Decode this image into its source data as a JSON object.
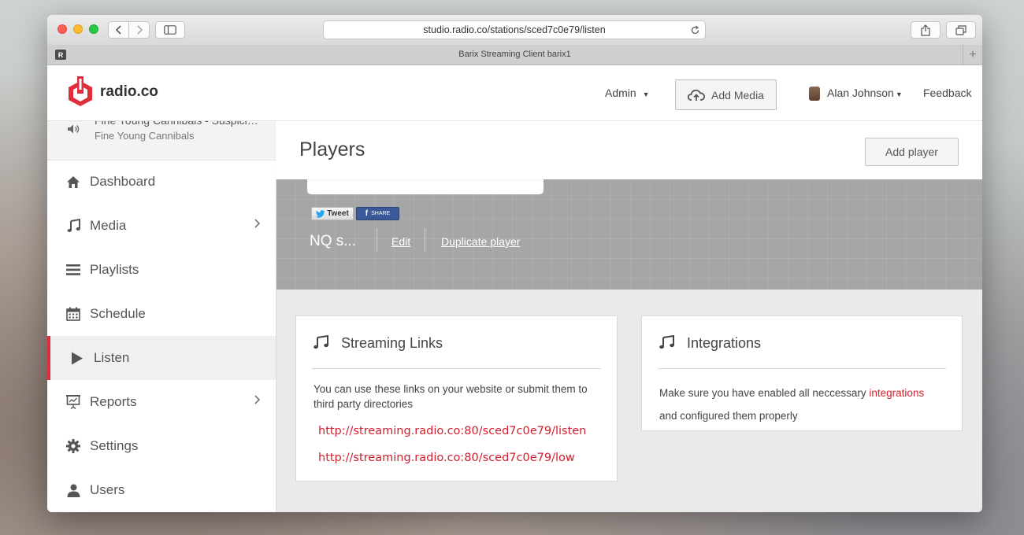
{
  "browser": {
    "url": "studio.radio.co/stations/sced7c0e79/listen",
    "tab_favicon": "R",
    "tab_title": "Barix Streaming Client barix1",
    "new_tab": "+"
  },
  "topnav": {
    "logo_text": "radio.co",
    "admin_label": "Admin",
    "add_media_label": "Add Media",
    "user_name": "Alan Johnson",
    "feedback_label": "Feedback"
  },
  "now_playing": {
    "title": "Fine Young Cannibals - Suspici…",
    "artist": "Fine Young Cannibals"
  },
  "sidebar": {
    "items": [
      {
        "label": "Dashboard",
        "icon": "home-icon"
      },
      {
        "label": "Media",
        "icon": "music-icon"
      },
      {
        "label": "Playlists",
        "icon": "list-icon"
      },
      {
        "label": "Schedule",
        "icon": "calendar-icon"
      },
      {
        "label": "Listen",
        "icon": "play-icon"
      },
      {
        "label": "Reports",
        "icon": "presentation-icon"
      },
      {
        "label": "Settings",
        "icon": "gear-icon"
      },
      {
        "label": "Users",
        "icon": "user-icon"
      }
    ]
  },
  "players": {
    "page_title": "Players",
    "add_player_label": "Add player",
    "tweet_label": "Tweet",
    "share_label": "SHARE",
    "player_name": "NQ s...",
    "edit_label": "Edit",
    "duplicate_label": "Duplicate player"
  },
  "streaming_links": {
    "title": "Streaming Links",
    "description": "You can use these links on your website or submit them to third party directories",
    "links": [
      "http://streaming.radio.co:80/sced7c0e79/listen",
      "http://streaming.radio.co:80/sced7c0e79/low"
    ]
  },
  "integrations": {
    "title": "Integrations",
    "text_before": "Make sure you have enabled all neccessary ",
    "link_label": "integrations",
    "text_after": "and configured them properly"
  },
  "colors": {
    "brand_red": "#e02d3c",
    "link_red": "#d01f2d",
    "banner_gray": "#a6a6a6"
  }
}
